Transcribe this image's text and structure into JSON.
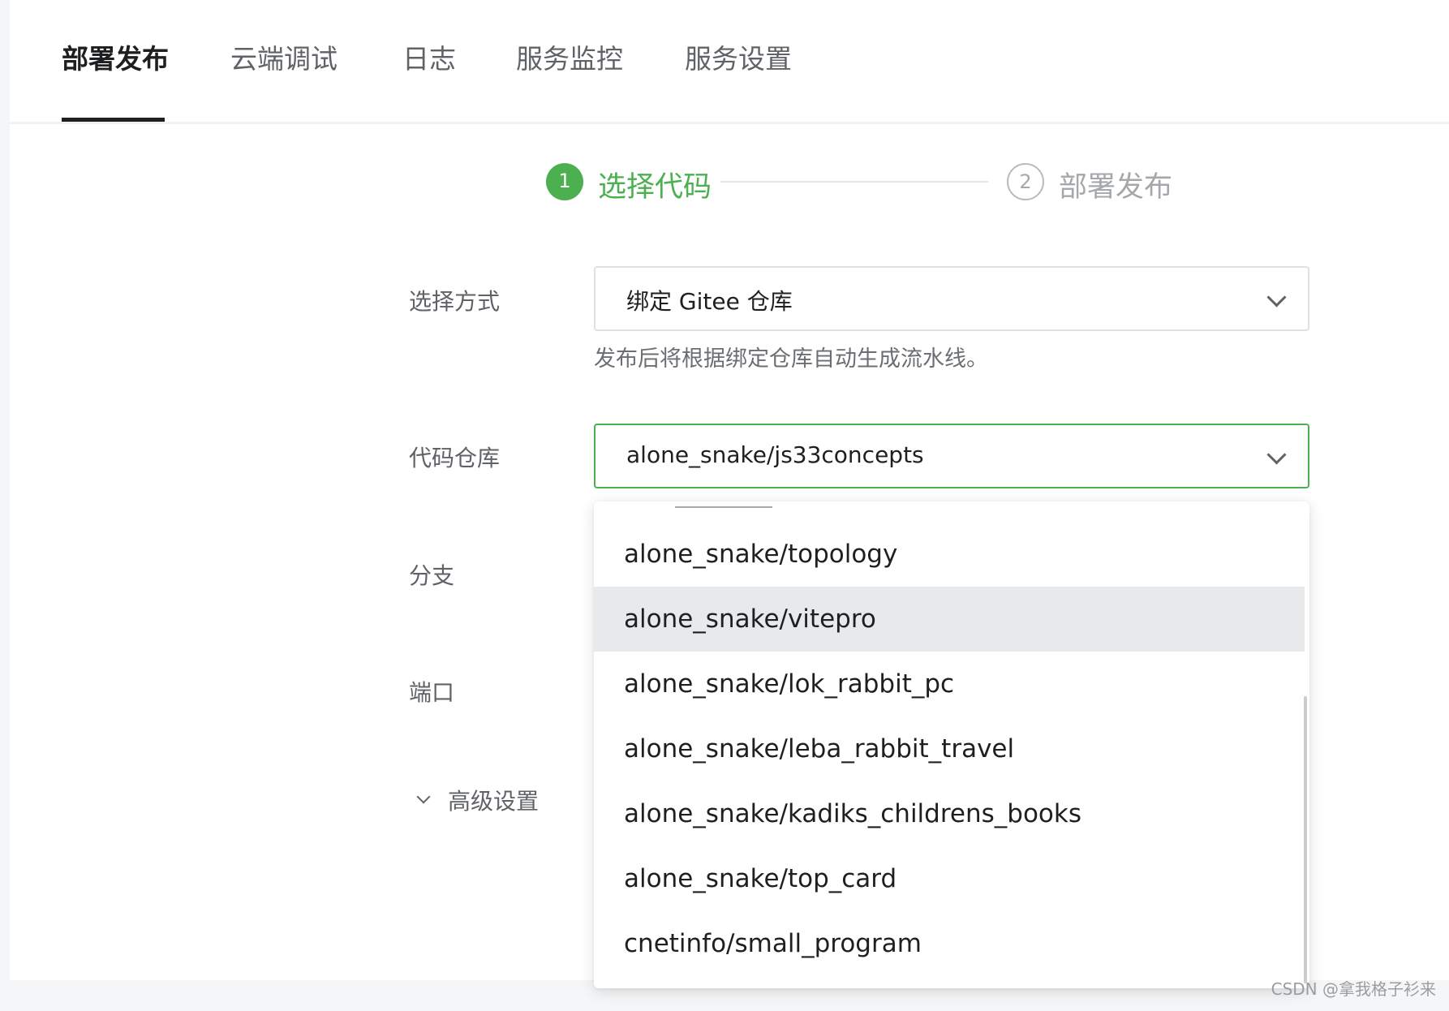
{
  "tabs": [
    {
      "label": "部署发布"
    },
    {
      "label": "云端调试"
    },
    {
      "label": "日志"
    },
    {
      "label": "服务监控"
    },
    {
      "label": "服务设置"
    }
  ],
  "steps": [
    {
      "number": "1",
      "label": "选择代码"
    },
    {
      "number": "2",
      "label": "部署发布"
    }
  ],
  "form": {
    "method_label": "选择方式",
    "method_value": "绑定 Gitee 仓库",
    "method_hint": "发布后将根据绑定仓库自动生成流水线。",
    "repo_label": "代码仓库",
    "repo_value": "alone_snake/js33concepts",
    "branch_label": "分支",
    "port_label": "端口",
    "advanced_label": "高级设置"
  },
  "dropdown": {
    "items": [
      "alone_snake/topology",
      "alone_snake/vitepro",
      "alone_snake/lok_rabbit_pc",
      "alone_snake/leba_rabbit_travel",
      "alone_snake/kadiks_childrens_books",
      "alone_snake/top_card",
      "cnetinfo/small_program"
    ],
    "hovered_index": 1
  },
  "watermark": "CSDN @拿我格子衫来",
  "colors": {
    "accent": "#4caf50",
    "text_primary": "#1d1f21",
    "text_secondary": "#5f6266",
    "hover_bg": "#e8e9ea"
  }
}
